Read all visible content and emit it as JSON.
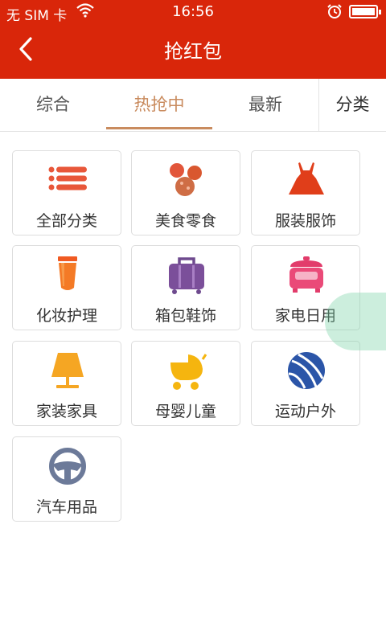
{
  "status_bar": {
    "carrier": "无 SIM 卡",
    "time": "16:56"
  },
  "header": {
    "title": "抢红包"
  },
  "tabs": [
    {
      "label": "综合"
    },
    {
      "label": "热抢中"
    },
    {
      "label": "最新"
    }
  ],
  "category_tab": {
    "label": "分类"
  },
  "colors": {
    "header_bg": "#d9260a",
    "active_tab": "#c98b5e"
  },
  "categories": [
    {
      "label": "全部分类",
      "icon": "list-icon"
    },
    {
      "label": "美食零食",
      "icon": "snack-icon"
    },
    {
      "label": "服装服饰",
      "icon": "dress-icon"
    },
    {
      "label": "化妆护理",
      "icon": "cosmetic-tube-icon"
    },
    {
      "label": "箱包鞋饰",
      "icon": "suitcase-icon"
    },
    {
      "label": "家电日用",
      "icon": "rice-cooker-icon"
    },
    {
      "label": "家装家具",
      "icon": "lamp-icon"
    },
    {
      "label": "母婴儿童",
      "icon": "stroller-icon"
    },
    {
      "label": "运动户外",
      "icon": "ball-icon"
    },
    {
      "label": "汽车用品",
      "icon": "steering-wheel-icon"
    }
  ]
}
